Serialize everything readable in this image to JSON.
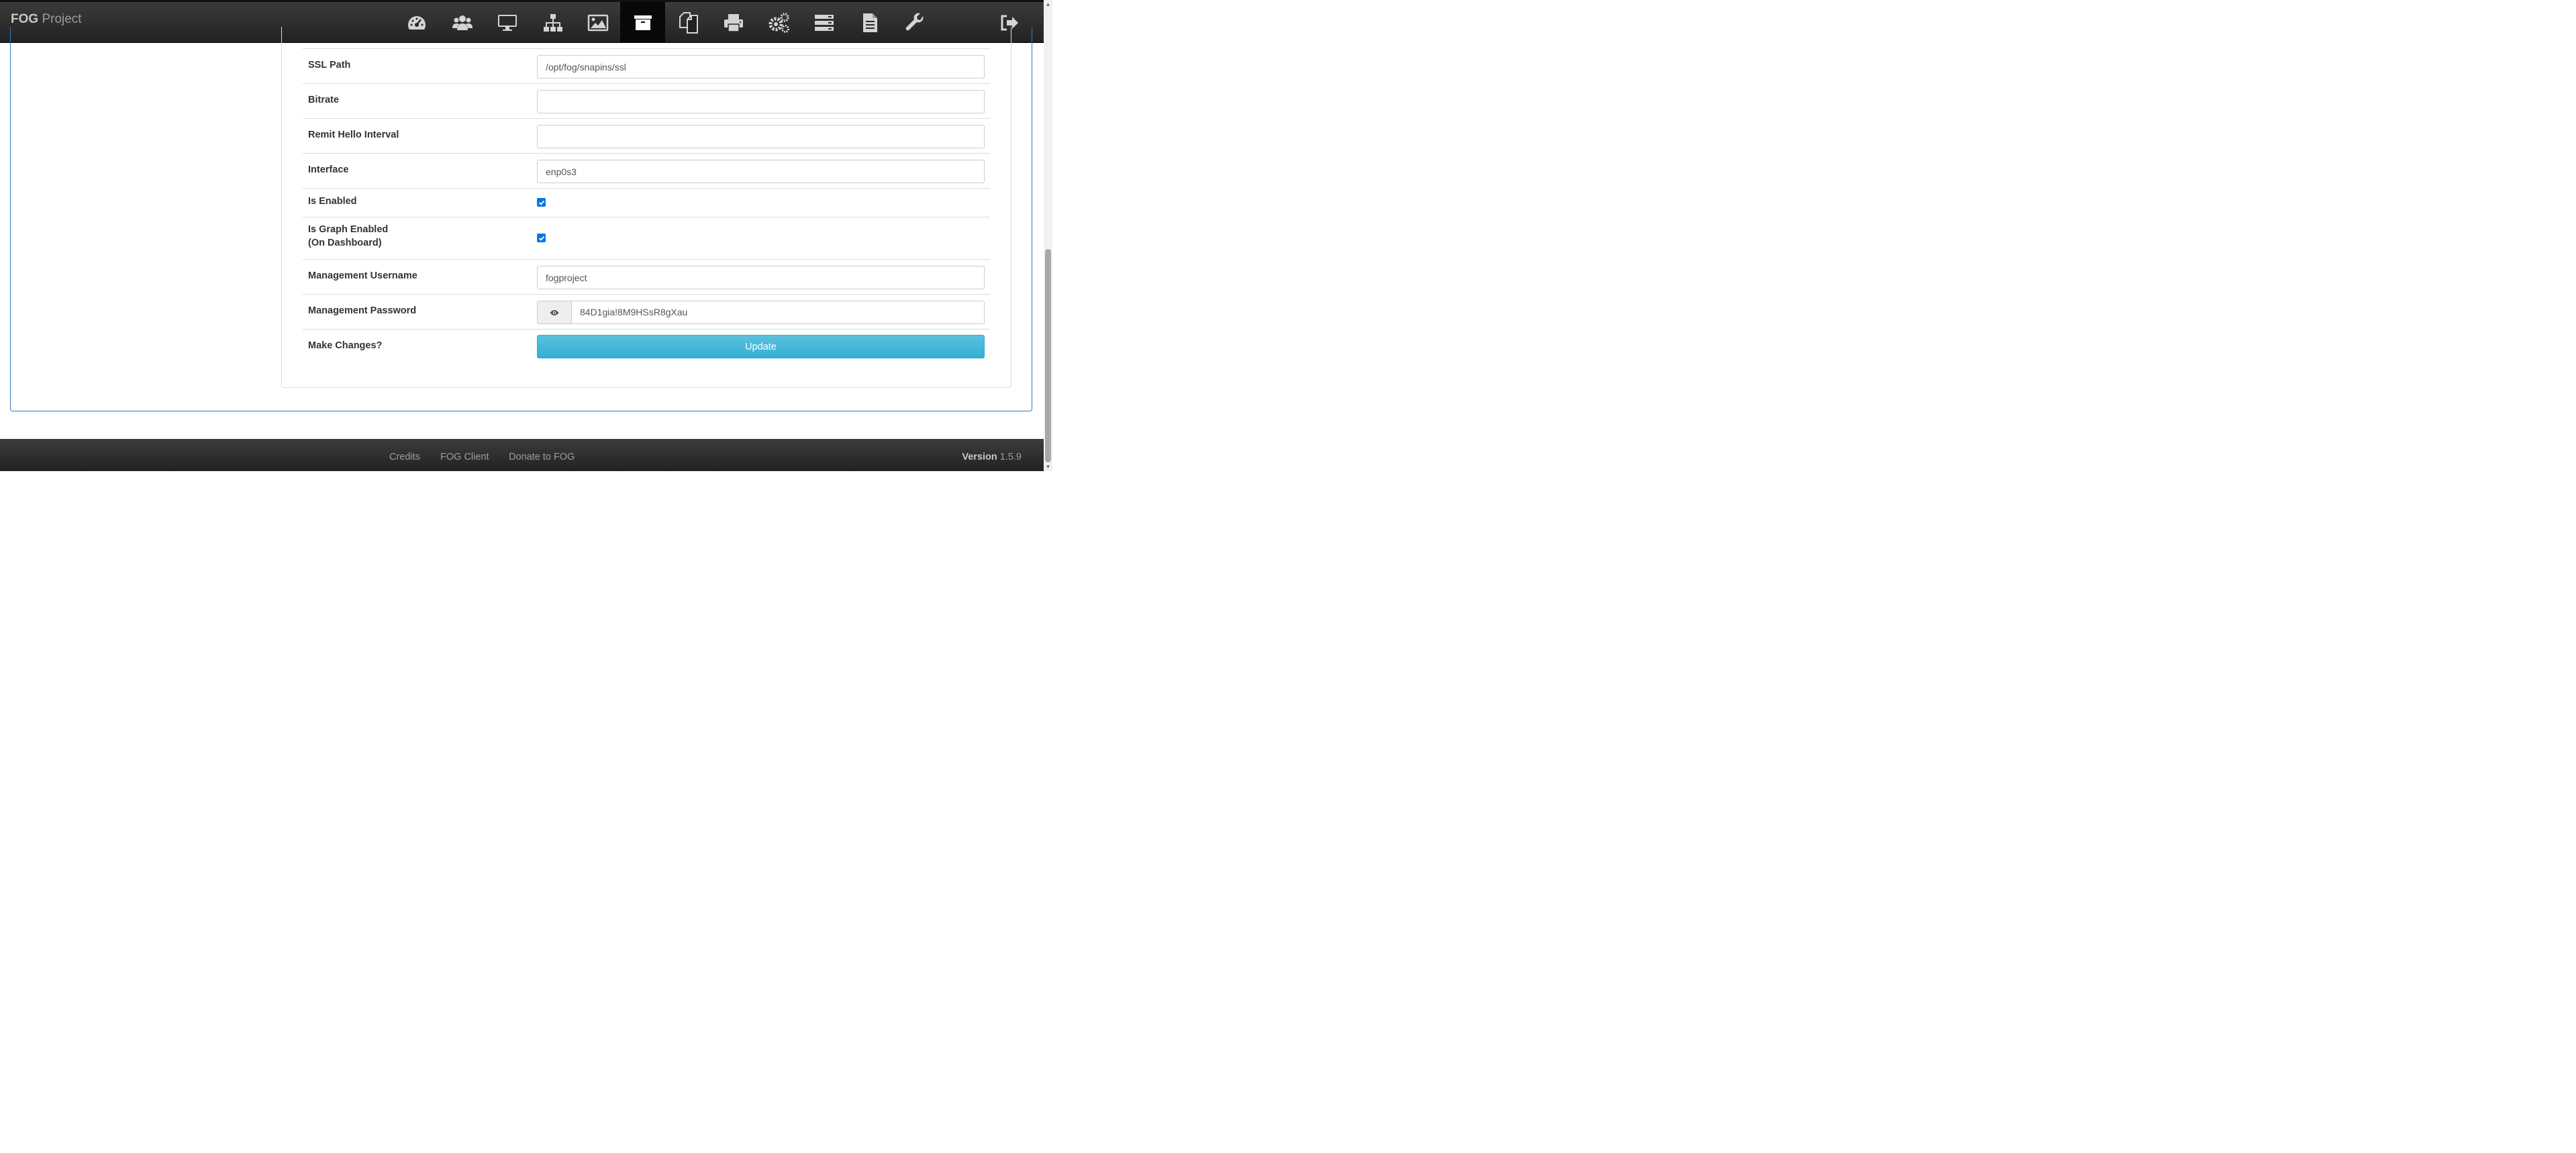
{
  "brand": {
    "bold": "FOG",
    "rest": " Project"
  },
  "nav": {
    "items": [
      {
        "icon": "dashboard-icon"
      },
      {
        "icon": "users-icon"
      },
      {
        "icon": "hosts-icon"
      },
      {
        "icon": "groups-icon"
      },
      {
        "icon": "images-icon"
      },
      {
        "icon": "storage-icon",
        "active": true
      },
      {
        "icon": "snapins-icon"
      },
      {
        "icon": "printers-icon"
      },
      {
        "icon": "services-icon"
      },
      {
        "icon": "tasks-icon"
      },
      {
        "icon": "reports-icon"
      },
      {
        "icon": "settings-icon"
      },
      {
        "icon": "logout-icon"
      }
    ]
  },
  "form": {
    "ssl_path": {
      "label": "SSL Path",
      "value": "/opt/fog/snapins/ssl"
    },
    "bitrate": {
      "label": "Bitrate",
      "value": ""
    },
    "remit_hello": {
      "label": "Remit Hello Interval",
      "value": ""
    },
    "interface": {
      "label": "Interface",
      "value": "enp0s3"
    },
    "is_enabled": {
      "label": "Is Enabled",
      "checked": true
    },
    "graph_enabled": {
      "label_line1": "Is Graph Enabled",
      "label_line2": "(On Dashboard)",
      "checked": true
    },
    "mgmt_username": {
      "label": "Management Username",
      "value": "fogproject"
    },
    "mgmt_password": {
      "label": "Management Password",
      "value": "84D1gia!8M9HSsR8gXau"
    },
    "make_changes": {
      "label": "Make Changes?",
      "button": "Update"
    }
  },
  "footer": {
    "links": [
      "Credits",
      "FOG Client",
      "Donate to FOG"
    ],
    "version_label": "Version",
    "version_number": " 1.5.9"
  },
  "colors": {
    "accent": "#337ab7",
    "button": "#31b0d5",
    "checkbox": "#0b76e3"
  }
}
